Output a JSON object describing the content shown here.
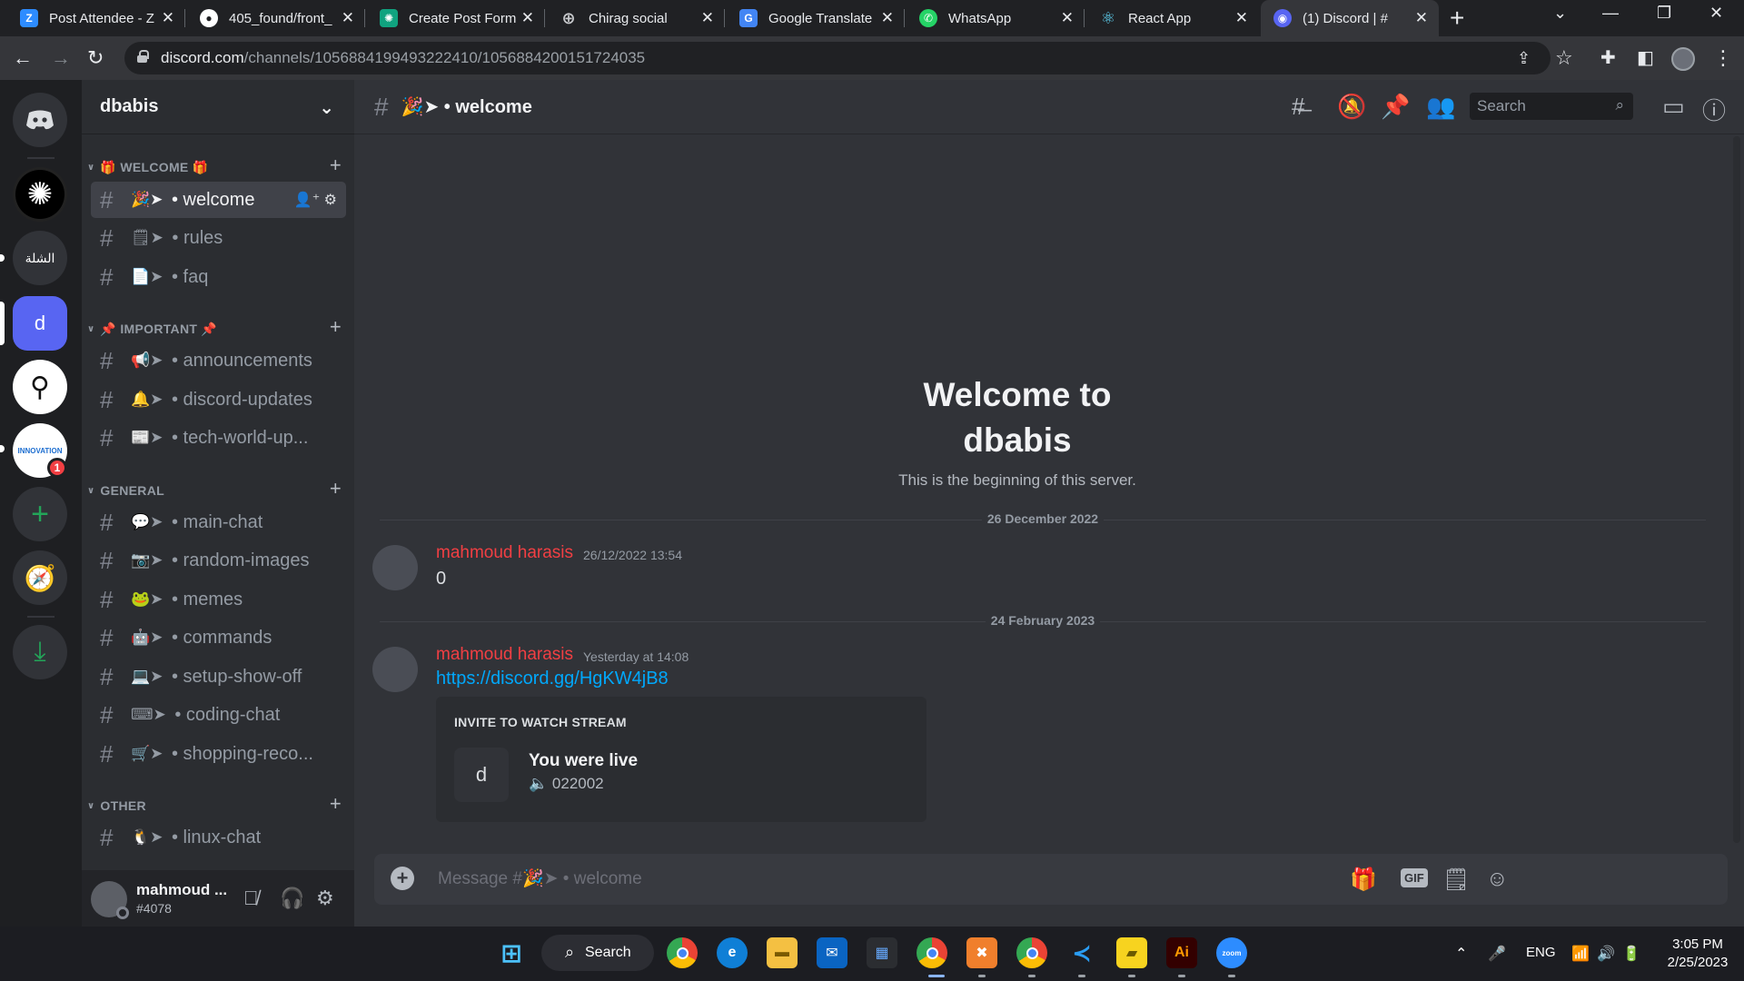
{
  "browser": {
    "tabs": [
      {
        "title": "Post Attendee - Z",
        "favicon": "Z",
        "color": "#2d8cff"
      },
      {
        "title": "405_found/front_",
        "favicon": "github-icon",
        "color": "#ffffff"
      },
      {
        "title": "Create Post Form",
        "favicon": "chatgpt-icon",
        "color": "#10a37f"
      },
      {
        "title": "Chirag social",
        "favicon": "globe-icon",
        "color": "#9aa0a6"
      },
      {
        "title": "Google Translate",
        "favicon": "G",
        "color": "#4285f4"
      },
      {
        "title": "WhatsApp",
        "favicon": "whatsapp-icon",
        "color": "#25d366"
      },
      {
        "title": "React App",
        "favicon": "react-icon",
        "color": "#61dafb"
      },
      {
        "title": "(1) Discord | #",
        "favicon": "discord-icon",
        "color": "#5865f2"
      }
    ],
    "url_host": "discord.com",
    "url_path": "/channels/1056884199493222410/1056884200151724035"
  },
  "servers": [
    {
      "name": "discord-home",
      "label": ""
    },
    {
      "name": "chatgpt-server",
      "label": ""
    },
    {
      "name": "arabic-server",
      "label": "الشلة"
    },
    {
      "name": "dbabis-server",
      "label": "d"
    },
    {
      "name": "pin-server",
      "label": ""
    },
    {
      "name": "innovation-server",
      "label": "INNOVATION",
      "badge": "1"
    }
  ],
  "guild": {
    "name": "dbabis"
  },
  "categories": {
    "welcome": "🎁 WELCOME 🎁",
    "important": "📌 IMPORTANT 📌",
    "general": "GENERAL",
    "other": "OTHER"
  },
  "channels": [
    {
      "emoji": "🎉➤",
      "name": "welcome",
      "active": true
    },
    {
      "emoji": "🗒➤",
      "name": "rules"
    },
    {
      "emoji": "📄➤",
      "name": "faq"
    },
    {
      "emoji": "📢➤",
      "name": "announcements"
    },
    {
      "emoji": "🔔➤",
      "name": "discord-updates"
    },
    {
      "emoji": "📰➤",
      "name": "tech-world-up..."
    },
    {
      "emoji": "💬➤",
      "name": "main-chat"
    },
    {
      "emoji": "📷➤",
      "name": "random-images"
    },
    {
      "emoji": "🐸➤",
      "name": "memes"
    },
    {
      "emoji": "🤖➤",
      "name": "commands"
    },
    {
      "emoji": "💻➤",
      "name": "setup-show-off"
    },
    {
      "emoji": "⌨➤",
      "name": "coding-chat"
    },
    {
      "emoji": "🛒➤",
      "name": "shopping-reco..."
    },
    {
      "emoji": "🐧➤",
      "name": "linux-chat"
    }
  ],
  "user": {
    "name": "mahmoud ...",
    "tag": "#4078"
  },
  "header": {
    "channel": "🎉➤ • welcome",
    "search_placeholder": "Search"
  },
  "welcome": {
    "title_1": "Welcome to",
    "title_2": "dbabis",
    "subtitle": "This is the beginning of this server."
  },
  "messages": [
    {
      "date": "26 December 2022",
      "author": "mahmoud harasis",
      "timestamp": "26/12/2022 13:54",
      "text": "0"
    },
    {
      "date": "24 February 2023",
      "author": "mahmoud harasis",
      "timestamp": "Yesterday at 14:08",
      "link": "https://discord.gg/HgKW4jB8"
    }
  ],
  "embed": {
    "heading": "INVITE TO WATCH STREAM",
    "avatar_letter": "d",
    "title": "You were live",
    "subtitle": "022002"
  },
  "composer": {
    "placeholder": "Message #🎉➤ • welcome",
    "gif_label": "GIF"
  },
  "taskbar": {
    "search_label": "Search",
    "lang": "ENG",
    "time": "3:05 PM",
    "date": "2/25/2023"
  },
  "colors": {
    "accent": "#5865f2",
    "author": "#f23f43",
    "link": "#00a8fc",
    "green": "#23a559"
  }
}
